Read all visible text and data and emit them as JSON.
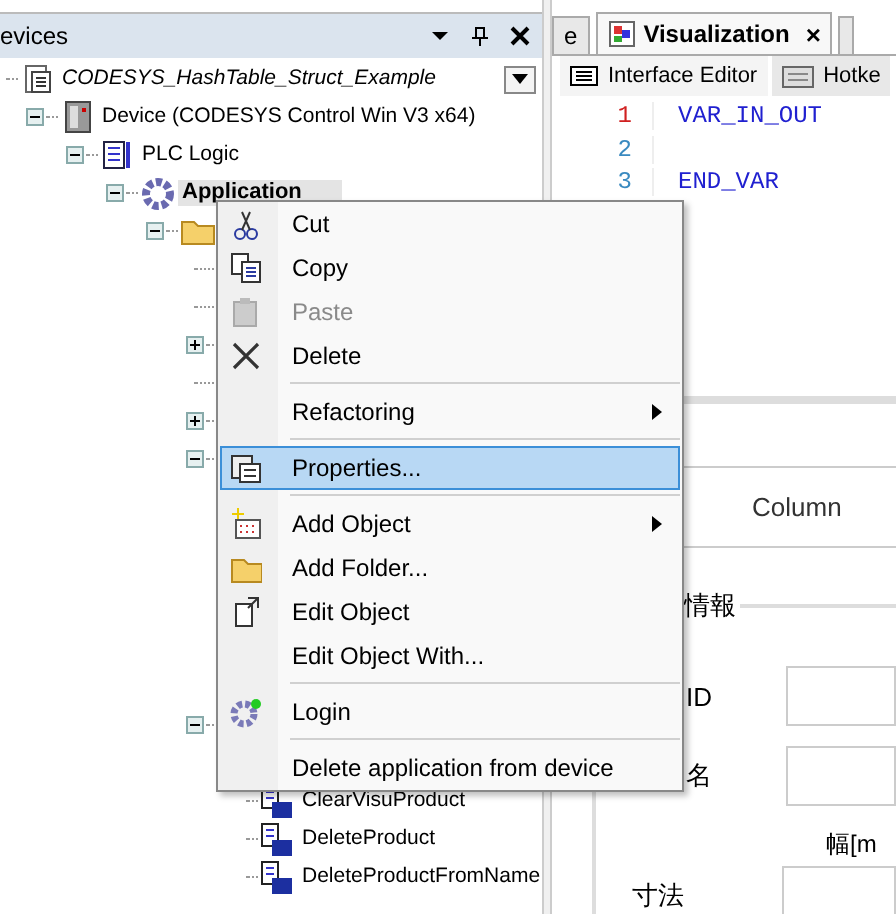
{
  "devices_panel": {
    "title": "evices",
    "tree": [
      {
        "label": "CODESYS_HashTable_Struct_Example",
        "kind": "project",
        "children": [
          {
            "label": "Device (CODESYS Control Win V3 x64)",
            "kind": "device",
            "expanded": true,
            "children": [
              {
                "label": "PLC Logic",
                "kind": "plc",
                "expanded": true,
                "children": [
                  {
                    "label": "Application",
                    "kind": "app",
                    "expanded": true,
                    "selected": true,
                    "children": [
                      {
                        "kind": "folder",
                        "expanded": true,
                        "children": [
                          {
                            "kind": "leaf"
                          },
                          {
                            "kind": "leaf"
                          },
                          {
                            "kind": "node",
                            "expanded": false
                          },
                          {
                            "kind": "leaf"
                          },
                          {
                            "kind": "node",
                            "expanded": false
                          },
                          {
                            "kind": "node",
                            "expanded": true,
                            "children": [
                              {
                                "kind": "leaf"
                              },
                              {
                                "kind": "leaf"
                              },
                              {
                                "kind": "leaf"
                              },
                              {
                                "kind": "leaf"
                              },
                              {
                                "kind": "leaf"
                              },
                              {
                                "kind": "leaf"
                              }
                            ]
                          },
                          {
                            "kind": "node",
                            "expanded": true,
                            "children": [
                              {
                                "kind": "leaf"
                              },
                              {
                                "label": "ClearVisuProduct",
                                "kind": "method"
                              },
                              {
                                "label": "DeleteProduct",
                                "kind": "method"
                              },
                              {
                                "label": "DeleteProductFromName",
                                "kind": "method"
                              }
                            ]
                          }
                        ]
                      }
                    ]
                  }
                ]
              }
            ]
          }
        ]
      }
    ]
  },
  "editor": {
    "tabs": [
      {
        "label": "e",
        "selected": false
      },
      {
        "label": "Visualization",
        "selected": true,
        "close": "×"
      }
    ],
    "subtabs": [
      {
        "label": "Interface Editor",
        "selected": true
      },
      {
        "label": "Hotke",
        "selected": false
      }
    ],
    "lines": [
      {
        "number": "1",
        "code": "VAR_IN_OUT",
        "current": true
      },
      {
        "number": "2",
        "current": false
      },
      {
        "number": "3",
        "code": "END_VAR",
        "current": false
      }
    ],
    "form": [
      {
        "kind": "header",
        "label": "Column"
      },
      {
        "kind": "group",
        "label": "情報"
      },
      {
        "kind": "field",
        "label": "ID"
      },
      {
        "kind": "field",
        "label": "名"
      },
      {
        "kind": "hint",
        "label": "幅[m"
      },
      {
        "kind": "field",
        "label": "寸法"
      }
    ]
  },
  "context_menu": [
    {
      "kind": "item",
      "label": "Cut",
      "disabled": false,
      "selected": false
    },
    {
      "kind": "item",
      "label": "Copy",
      "disabled": false,
      "selected": false
    },
    {
      "kind": "item",
      "label": "Paste",
      "disabled": true,
      "selected": false
    },
    {
      "kind": "item",
      "label": "Delete",
      "disabled": false,
      "selected": false
    },
    {
      "kind": "separator"
    },
    {
      "kind": "item",
      "label": "Refactoring",
      "submenu": true,
      "disabled": false,
      "selected": false
    },
    {
      "kind": "separator"
    },
    {
      "kind": "item",
      "label": "Properties...",
      "disabled": false,
      "selected": true
    },
    {
      "kind": "separator"
    },
    {
      "kind": "item",
      "label": "Add Object",
      "submenu": true,
      "disabled": false,
      "selected": false
    },
    {
      "kind": "item",
      "label": "Add Folder...",
      "disabled": false,
      "selected": false
    },
    {
      "kind": "item",
      "label": "Edit Object",
      "disabled": false,
      "selected": false
    },
    {
      "kind": "item",
      "label": "Edit Object With...",
      "disabled": false,
      "selected": false
    },
    {
      "kind": "separator"
    },
    {
      "kind": "item",
      "label": "Login",
      "disabled": false,
      "selected": false
    },
    {
      "kind": "separator"
    },
    {
      "kind": "item",
      "label": "Delete application from device",
      "disabled": false,
      "selected": false
    }
  ]
}
